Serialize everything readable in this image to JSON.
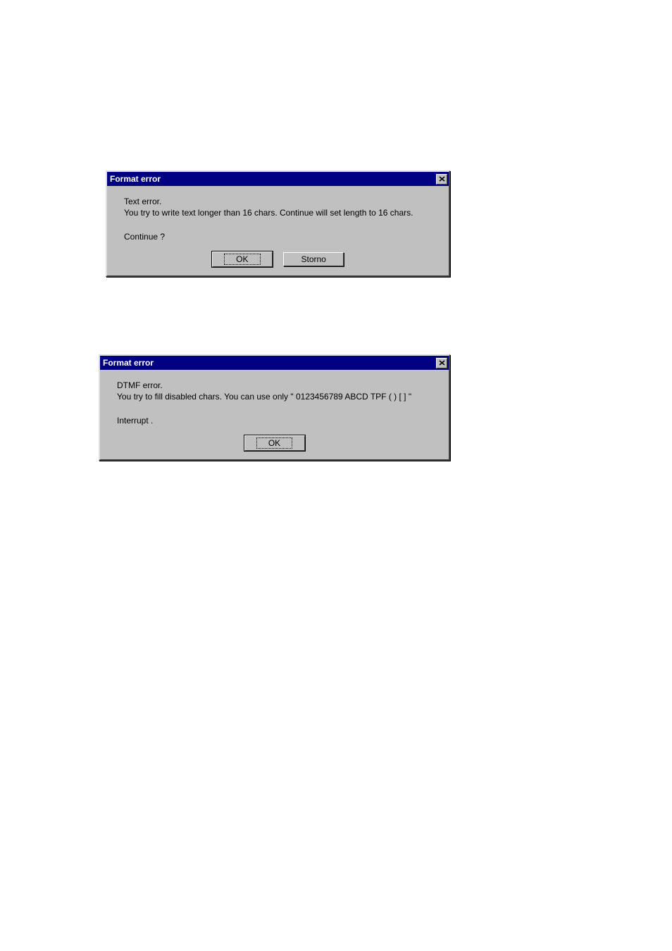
{
  "dialog1": {
    "title": "Format error",
    "line1": "Text error.",
    "line2": "You try to write text longer than 16 chars. Continue will set length to 16 chars.",
    "line3": "Continue ?",
    "ok_label": "OK",
    "cancel_label": "Storno"
  },
  "dialog2": {
    "title": "Format error",
    "line1": "DTMF error.",
    "line2": "You try to fill disabled chars. You can use only \" 0123456789 ABCD TPF ( ) [ ] \"",
    "line3": "Interrupt .",
    "ok_label": "OK"
  }
}
